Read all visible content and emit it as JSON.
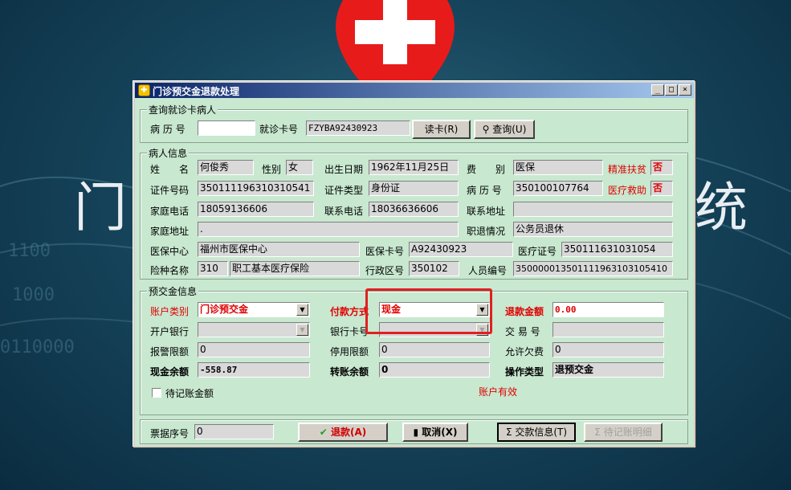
{
  "background": {
    "title_left": "门",
    "title_right": "统",
    "digits": [
      "1100",
      "0110000",
      "1000"
    ]
  },
  "window": {
    "title": "门诊预交金退款处理",
    "controls": {
      "minimize": "_",
      "maximize": "□",
      "close": "×"
    }
  },
  "query": {
    "legend": "查询就诊卡病人",
    "record_label": "病 历 号",
    "record_value": "",
    "card_label": "就诊卡号",
    "card_value": "FZYBA92430923",
    "read_card": "读卡(R)",
    "query": "查询(U)"
  },
  "patient": {
    "legend": "病人信息",
    "name_label": "姓　　名",
    "name": "何俊秀",
    "sex_label": "性别",
    "sex": "女",
    "dob_label": "出生日期",
    "dob": "1962年11月25日",
    "fee_label": "费　　别",
    "fee": "医保",
    "poverty_label": "精准扶贫",
    "poverty": "否",
    "idno_label": "证件号码",
    "idno": "350111196310310541",
    "idtype_label": "证件类型",
    "idtype": "身份证",
    "record_label": "病 历 号",
    "record": "350100107764",
    "aid_label": "医疗救助",
    "aid": "否",
    "homephone_label": "家庭电话",
    "homephone": "18059136606",
    "contactphone_label": "联系电话",
    "contactphone": "18036636606",
    "contactaddr_label": "联系地址",
    "contactaddr": "",
    "homeaddr_label": "家庭地址",
    "homeaddr": ".",
    "job_label": "职退情况",
    "job": "公务员退休",
    "center_label": "医保中心",
    "center": "福州市医保中心",
    "inscard_label": "医保卡号",
    "inscard": "A92430923",
    "cert_label": "医疗证号",
    "cert": "350111631031054",
    "type_label": "险种名称",
    "type_code": "310",
    "type_name": "职工基本医疗保险",
    "region_label": "行政区号",
    "region": "350102",
    "staff_label": "人员编号",
    "staff": "350000013501111963103105410"
  },
  "deposit": {
    "legend": "预交金信息",
    "account_label": "账户类别",
    "account": "门诊预交金",
    "pay_label": "付款方式",
    "pay": "现金",
    "refund_label": "退款金额",
    "refund": "0.00",
    "bank_label": "开户银行",
    "bank": "",
    "bankcard_label": "银行卡号",
    "bankcard": "",
    "trade_label": "交 易 号",
    "trade": "",
    "alarm_label": "报警限额",
    "alarm": "0",
    "stop_label": "停用限额",
    "stop": "0",
    "arrears_label": "允许欠费",
    "arrears": "0",
    "cash_label": "现金余额",
    "cash": "-558.87",
    "transfer_label": "转账余额",
    "transfer": "0",
    "optype_label": "操作类型",
    "optype": "退预交金",
    "pending_label": "待记账金额",
    "status": "账户有效"
  },
  "footer": {
    "ticket_label": "票据序号",
    "ticket": "0",
    "refund_btn": "退款(A)",
    "cancel_btn": "取消(X)",
    "payinfo_btn": "交款信息(T)",
    "pending_btn": "待记账明细"
  }
}
